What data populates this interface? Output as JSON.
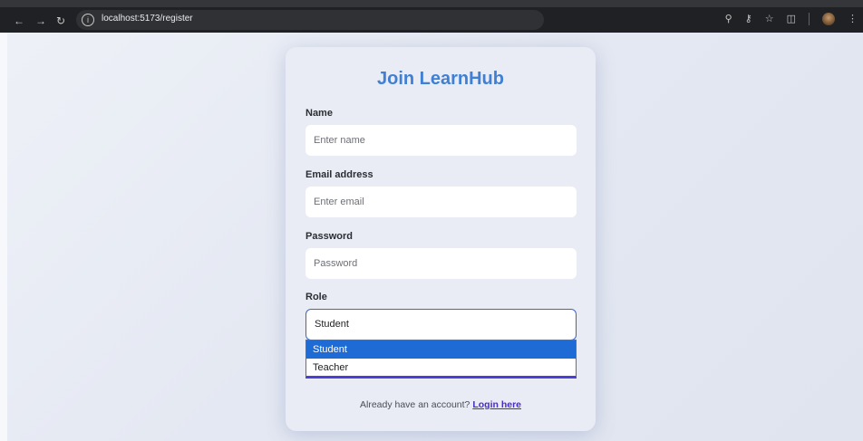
{
  "browser": {
    "url": "localhost:5173/register"
  },
  "form": {
    "title": "Join LearnHub",
    "name_label": "Name",
    "name_placeholder": "Enter name",
    "email_label": "Email address",
    "email_placeholder": "Enter email",
    "password_label": "Password",
    "password_placeholder": "Password",
    "role_label": "Role",
    "role_selected": "Student",
    "role_options": [
      "Student",
      "Teacher"
    ],
    "footer_text": "Already have an account?",
    "login_link": "Login here"
  },
  "colors": {
    "title": "#3f7fd4",
    "selected_option": "#1e6bd6",
    "link": "#4a2bc4"
  }
}
